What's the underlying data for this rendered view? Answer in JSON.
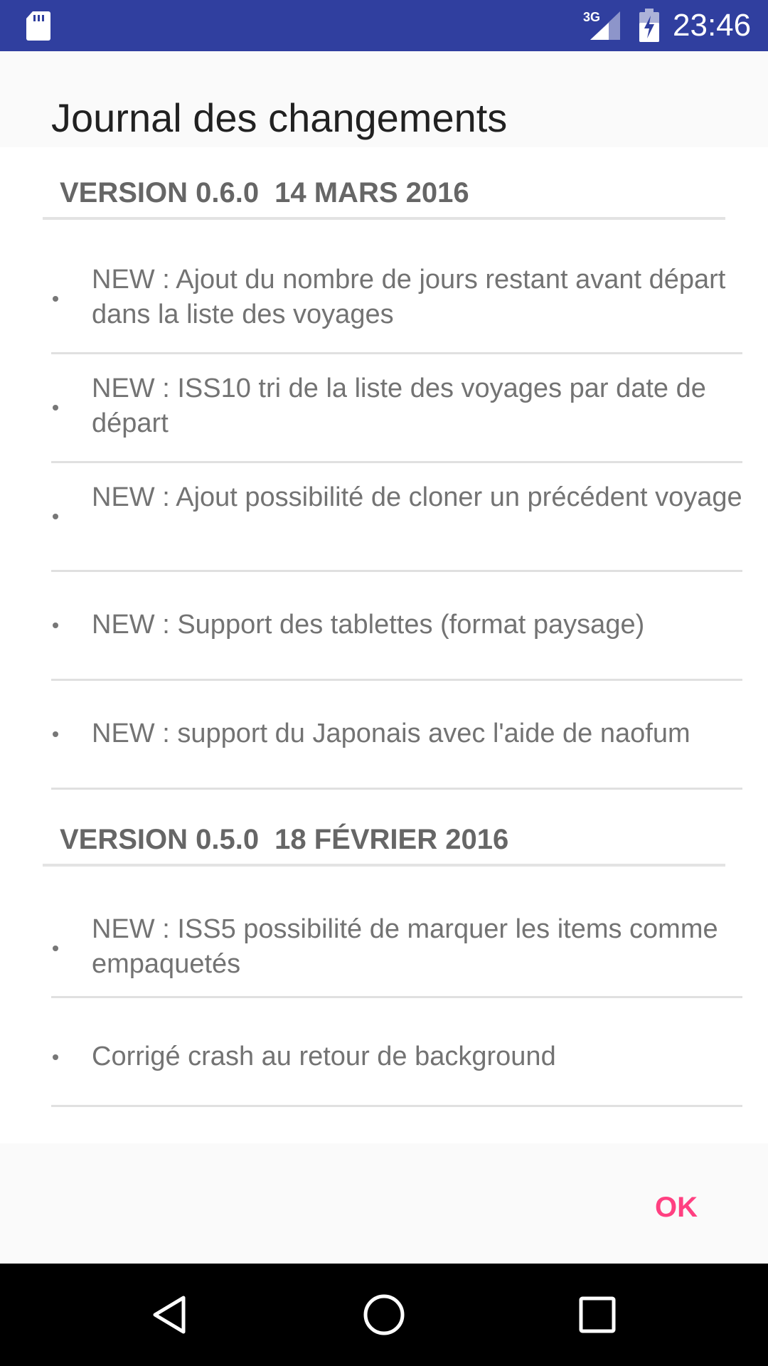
{
  "status_bar": {
    "time": "23:46",
    "network_label": "3G",
    "icons": [
      "sd-card-icon",
      "signal-3g-icon",
      "battery-charging-icon"
    ]
  },
  "dialog": {
    "title": "Journal des changements",
    "ok_label": "OK",
    "accent_color": "#ff4081"
  },
  "changelog": [
    {
      "version": "VERSION 0.6.0",
      "date": "14 MARS 2016",
      "changes": [
        "NEW : Ajout du nombre de jours restant avant départ dans la liste des voyages",
        "NEW : ISS10 tri de la liste des voyages par date de départ",
        "NEW : Ajout possibilité de cloner un précédent voyage",
        "NEW : Support des tablettes (format paysage)",
        "NEW : support du Japonais avec l'aide de naofum"
      ]
    },
    {
      "version": "VERSION 0.5.0",
      "date": "18 FÉVRIER 2016",
      "changes": [
        "NEW : ISS5 possibilité de marquer les items comme empaquetés",
        "Corrigé crash au retour de background"
      ]
    }
  ],
  "nav_bar": {
    "buttons": [
      "back-icon",
      "home-icon",
      "recents-icon"
    ]
  },
  "colors": {
    "status_bar": "#303f9f",
    "nav_bar": "#000000",
    "accent": "#ff4081"
  }
}
